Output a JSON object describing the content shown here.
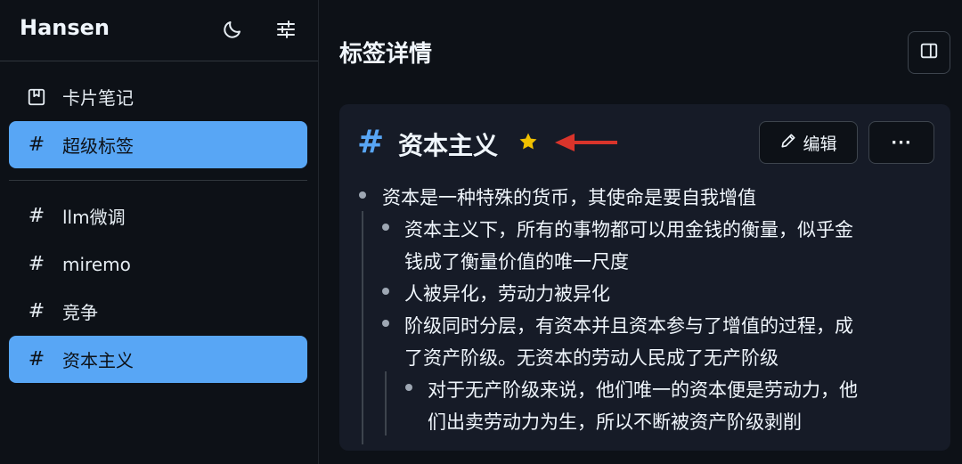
{
  "sidebar": {
    "app_title": "Hansen",
    "header_icons": [
      "moon-icon",
      "sliders-icon"
    ],
    "primary_items": [
      {
        "label": "卡片笔记",
        "icon": "bookmark-icon",
        "active": false
      },
      {
        "label": "超级标签",
        "icon": "hash-icon",
        "active": true
      }
    ],
    "tags": [
      {
        "label": "llm微调",
        "icon": "hash-icon",
        "active": false
      },
      {
        "label": "miremo",
        "icon": "hash-icon",
        "active": false
      },
      {
        "label": "竞争",
        "icon": "hash-icon",
        "active": false
      },
      {
        "label": "资本主义",
        "icon": "hash-icon",
        "active": true
      }
    ]
  },
  "main": {
    "title": "标签详情",
    "panel_toggle_icon": "sidebar-panel-icon"
  },
  "tag": {
    "hash": "#",
    "name": "资本主义",
    "starred": true,
    "edit_label": "编辑",
    "more_label": "···",
    "accent_color": "#58a6f5",
    "star_color": "#f0c000",
    "arrow_color": "#d9342b"
  },
  "content": {
    "l1": "资本是一种特殊的货币，其使命是要自我增值",
    "l2a": "资本主义下，所有的事物都可以用金钱的衡量，似乎金",
    "l2b": "钱成了衡量价值的唯一尺度",
    "l3": "人被异化，劳动力被异化",
    "l4a": "阶级同时分层，有资本并且资本参与了增值的过程，成",
    "l4b": "了资产阶级。无资本的劳动人民成了无产阶级",
    "l5a": "对于无产阶级来说，他们唯一的资本便是劳动力，他",
    "l5b": "们出卖劳动力为生，所以不断被资产阶级剥削"
  }
}
